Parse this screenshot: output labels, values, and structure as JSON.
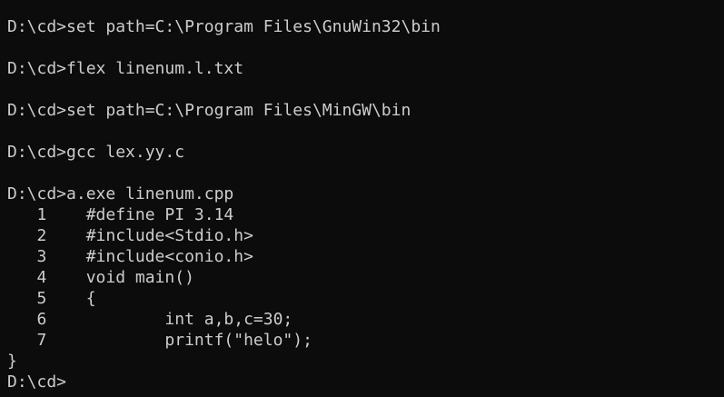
{
  "theme": {
    "background": "#0c0c0c",
    "foreground": "#cccccc"
  },
  "console": {
    "lines": [
      "D:\\cd>set path=C:\\Program Files\\GnuWin32\\bin",
      "",
      "D:\\cd>flex linenum.l.txt",
      "",
      "D:\\cd>set path=C:\\Program Files\\MinGW\\bin",
      "",
      "D:\\cd>gcc lex.yy.c",
      "",
      "D:\\cd>a.exe linenum.cpp",
      "   1    #define PI 3.14",
      "   2    #include<Stdio.h>",
      "   3    #include<conio.h>",
      "   4    void main()",
      "   5    {",
      "   6            int a,b,c=30;",
      "   7            printf(\"helo\");",
      "}",
      "D:\\cd>"
    ]
  }
}
